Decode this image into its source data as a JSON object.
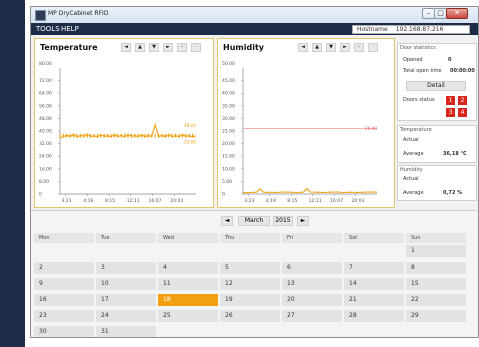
{
  "window": {
    "title": "MP DryCabinet RFID"
  },
  "menu": {
    "tools": "TOOLS",
    "help": "HELP"
  },
  "hostname": {
    "label": "Hostname",
    "value": "192.168.87.216"
  },
  "temperature_panel": {
    "title": "Temperature",
    "controls": [
      "◄",
      "▲",
      "▼",
      "►",
      "+",
      "-"
    ],
    "chart_data": {
      "type": "line",
      "title": "Temperature",
      "y_unit_label": "80.00",
      "yticks": [
        "72.00",
        "64.00",
        "56.00",
        "48.00",
        "40.00",
        "32.00",
        "24.00",
        "16.00",
        "8.00",
        "0"
      ],
      "ylim": [
        0,
        80
      ],
      "xticks": [
        "3:23",
        "4:19",
        "8:15",
        "12:11",
        "16:07",
        "20:03"
      ],
      "series": [
        {
          "x": [
            0.0,
            0.5,
            1.0,
            1.5,
            2.0,
            2.5,
            3.0,
            3.5,
            4.0,
            4.5,
            5.0,
            5.5,
            6.0,
            6.5,
            7.0,
            7.5,
            8.0,
            8.5,
            9.0,
            9.5,
            10.0,
            10.5,
            11.0,
            11.5,
            12.0,
            12.5,
            13.0,
            13.5,
            14.0,
            14.5,
            15.0,
            15.5,
            16.0,
            16.5,
            17.0,
            17.5,
            18.0,
            18.5,
            19.0,
            19.5,
            20.0
          ],
          "y": [
            36.0,
            36.2,
            37.5,
            36.4,
            38.0,
            36.1,
            37.2,
            36.6,
            38.1,
            36.3,
            37.0,
            36.2,
            37.8,
            36.5,
            37.1,
            36.2,
            37.9,
            36.4,
            37.3,
            36.2,
            38.0,
            36.6,
            37.1,
            36.3,
            37.7,
            36.2,
            37.2,
            36.5,
            44.0,
            36.3,
            37.4,
            36.2,
            37.9,
            36.4,
            37.0,
            36.3,
            37.8,
            36.5,
            37.1,
            36.2,
            37.0
          ]
        }
      ],
      "annotations": [
        "48.00",
        "33.00"
      ],
      "line_color": "#f0a010"
    }
  },
  "humidity_panel": {
    "title": "Humidity",
    "controls": [
      "◄",
      "▲",
      "▼",
      "►",
      "+",
      "-"
    ],
    "chart_data": {
      "type": "line",
      "title": "Humidity",
      "y_unit_label": "50.00",
      "yticks": [
        "45.00",
        "40.00",
        "35.00",
        "30.00",
        "25.00",
        "20.00",
        "15.00",
        "10.00",
        "5.00",
        "0"
      ],
      "ylim": [
        0,
        50
      ],
      "xticks": [
        "3:23",
        "4:19",
        "8:15",
        "12:11",
        "16:07",
        "20:03"
      ],
      "series": [
        {
          "x": [
            0,
            1,
            2,
            2.5,
            3,
            3.5,
            4,
            5,
            6,
            7,
            8,
            9,
            9.5,
            10,
            11,
            12,
            13,
            14,
            15,
            16,
            17,
            18,
            19,
            20
          ],
          "y": [
            0.5,
            0.6,
            0.7,
            2.0,
            0.8,
            0.6,
            0.7,
            0.6,
            0.8,
            0.7,
            0.6,
            0.7,
            2.2,
            0.8,
            0.7,
            0.6,
            0.7,
            0.8,
            0.6,
            0.7,
            0.6,
            0.7,
            0.8,
            0.7
          ]
        }
      ],
      "limit_line": 26.0,
      "annotations": [
        "26.00"
      ],
      "line_color": "#f0a010",
      "limit_color": "#e86060"
    }
  },
  "door_statistics": {
    "header": "Door statistics",
    "opened_label": "Opened",
    "opened_value": "0",
    "open_time_label": "Total open time",
    "open_time_value": "00:00:00",
    "detail_button": "Detail",
    "doors_status_label": "Doors status",
    "doors": [
      "1",
      "2",
      "3",
      "4"
    ]
  },
  "temperature_stats": {
    "header": "Temperature",
    "actual_label": "Actual",
    "actual_value": "",
    "average_label": "Average",
    "average_value": "36,18 °C"
  },
  "humidity_stats": {
    "header": "Humidity",
    "actual_label": "Actual",
    "actual_value": "",
    "average_label": "Average",
    "average_value": "0,72 %"
  },
  "calendar": {
    "prev": "◄",
    "next": "►",
    "month": "March",
    "year": "2015",
    "day_headers": [
      "Mon",
      "Tue",
      "Wed",
      "Thu",
      "Fri",
      "Sat",
      "Sun"
    ],
    "weeks": [
      [
        "",
        "",
        "",
        "",
        "",
        "",
        "1"
      ],
      [
        "2",
        "3",
        "4",
        "5",
        "6",
        "7",
        "8"
      ],
      [
        "9",
        "10",
        "11",
        "12",
        "13",
        "14",
        "15"
      ],
      [
        "16",
        "17",
        "18",
        "19",
        "20",
        "21",
        "22"
      ],
      [
        "23",
        "24",
        "25",
        "26",
        "27",
        "28",
        "29"
      ],
      [
        "30",
        "31",
        "",
        "",
        "",
        "",
        ""
      ]
    ],
    "selected_day": "18",
    "selected_color": "#f0a010"
  }
}
